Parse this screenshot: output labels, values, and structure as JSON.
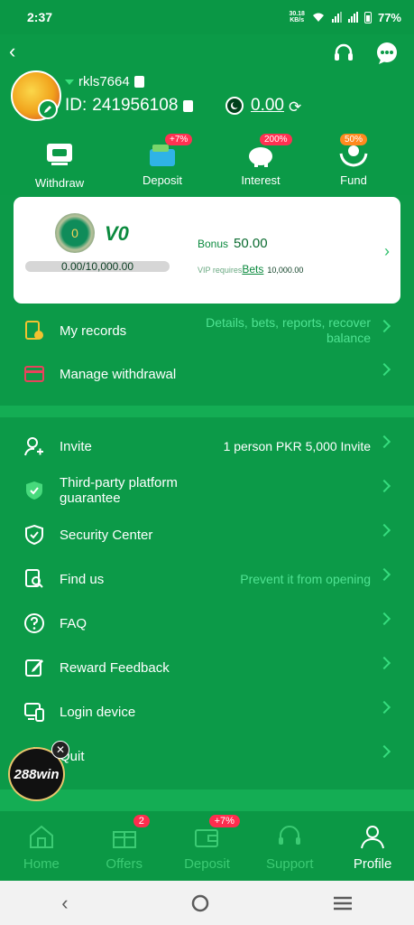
{
  "status_bar": {
    "time": "2:37",
    "net_speed": "30.18",
    "net_unit": "KB/s",
    "battery": "77%"
  },
  "header": {
    "username": "rkls7664",
    "id_label": "ID:",
    "id_value": "241956108",
    "balance": "0.00"
  },
  "quick_actions": [
    {
      "label": "Withdraw",
      "icon": "atm-icon",
      "badge": ""
    },
    {
      "label": "Deposit",
      "icon": "wallet-icon",
      "badge": "+7%"
    },
    {
      "label": "Interest",
      "icon": "piggy-bank-icon",
      "badge": "200%"
    },
    {
      "label": "Fund",
      "icon": "hands-icon",
      "badge": "50%"
    }
  ],
  "vip": {
    "medal": "0",
    "level": "V0",
    "progress_text": "0.00/10,000.00",
    "progress": 0,
    "bonus_label": "Bonus",
    "bonus_value": "50.00",
    "req_prefix": "VIP requires",
    "req_link": "Bets",
    "req_value": "10,000.00"
  },
  "menu_top": [
    {
      "label": "My records",
      "note": "Details, bets, reports, recover balance",
      "icon": "records-icon"
    },
    {
      "label": "Manage withdrawal",
      "note": "",
      "icon": "card-icon"
    }
  ],
  "menu_bottom": [
    {
      "label": "Invite",
      "note": "1 person PKR 5,000  Invite",
      "icon": "invite-icon"
    },
    {
      "label": "Third-party platform guarantee",
      "note": "",
      "icon": "shield-check-icon"
    },
    {
      "label": "Security Center",
      "note": "",
      "icon": "shield-icon"
    },
    {
      "label": "Find us",
      "note": "Prevent it from opening",
      "icon": "find-icon"
    },
    {
      "label": "FAQ",
      "note": "",
      "icon": "question-icon"
    },
    {
      "label": "Reward Feedback",
      "note": "",
      "icon": "edit-icon"
    },
    {
      "label": "Login device",
      "note": "",
      "icon": "devices-icon"
    },
    {
      "label": "Quit",
      "note": "",
      "icon": "quit-icon"
    }
  ],
  "floating_ad": {
    "text": "288win"
  },
  "bottom_nav": [
    {
      "label": "Home",
      "badge": ""
    },
    {
      "label": "Offers",
      "badge": "2"
    },
    {
      "label": "Deposit",
      "badge": "+7%"
    },
    {
      "label": "Support",
      "badge": ""
    },
    {
      "label": "Profile",
      "badge": ""
    }
  ],
  "colors": {
    "primary": "#0b9a47",
    "accent": "#36dc7e",
    "badge": "#ff2d4e"
  }
}
